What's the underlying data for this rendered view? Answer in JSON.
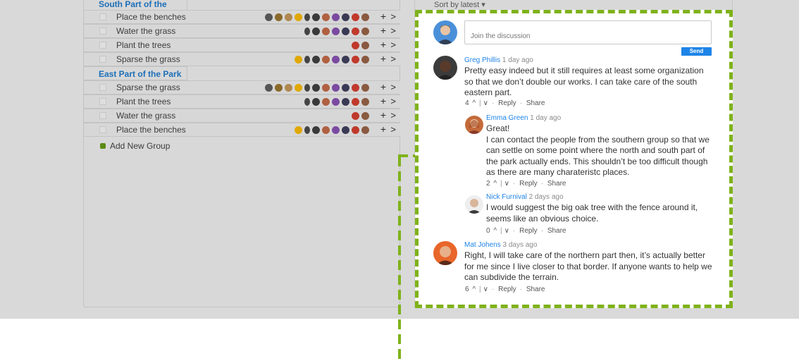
{
  "tasks": {
    "groups": [
      {
        "title": "South Part of the Park",
        "rows": [
          {
            "name": "Place the benches"
          },
          {
            "name": "Water the grass"
          },
          {
            "name": "Plant the trees"
          },
          {
            "name": "Sparse the grass"
          }
        ]
      },
      {
        "title": "East Part of the Park",
        "rows": [
          {
            "name": "Sparse the grass"
          },
          {
            "name": "Plant the trees"
          },
          {
            "name": "Water the grass"
          },
          {
            "name": "Place the benches"
          }
        ]
      }
    ],
    "add_group_label": "Add New Group",
    "row_add_glyph": "+",
    "row_chevron_glyph": ">"
  },
  "sort": {
    "label": "Sort by latest ▾"
  },
  "discussion": {
    "input_placeholder": "Join the discussion",
    "send_label": "Send",
    "comments": [
      {
        "author": "Greg Phillis",
        "time": "1 day ago",
        "text": "Pretty easy indeed but it still requires at least some organization so that we don’t double our works. I can take care of the south eastern part.",
        "votes": "4",
        "reply": "Reply",
        "share": "Share"
      },
      {
        "author": "Emma Green",
        "time": "1 day ago",
        "text": "Great!\nI can contact the people from the southern group so that we can settle on some point where the north and south part of the park actually ends. This shouldn’t be too difficult though as there are many charateristc places.",
        "votes": "2",
        "reply": "Reply",
        "share": "Share"
      },
      {
        "author": "Nick Furnival",
        "time": "2 days ago",
        "text": "I would suggest the big oak tree with the fence around it, seems like an obvious choice.",
        "votes": "0",
        "reply": "Reply",
        "share": "Share"
      },
      {
        "author": "Mat Johens",
        "time": "3 days ago",
        "text": "Right, I will take care of the northern part then, it’s actually better for me since I live closer to that border. If anyone wants to help we can subdivide the terrain.",
        "votes": "6",
        "reply": "Reply",
        "share": "Share"
      }
    ]
  },
  "colors": {
    "accent": "#1e84e8",
    "highlight": "#7fb21b",
    "group_title": "#1c6fb8"
  }
}
